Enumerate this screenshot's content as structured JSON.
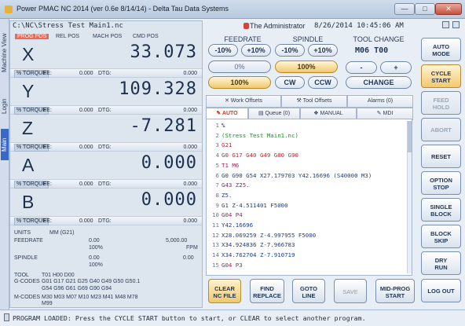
{
  "window": {
    "title": "Power PMAC NC 2014 (ver 0.6e 8/14/14) - Delta Tau Data Systems",
    "min": "—",
    "max": "□",
    "close": "✕"
  },
  "left_tabs": [
    "Machine View",
    "Login",
    "Main"
  ],
  "path": "C:\\NC\\Stress Test Main1.nc",
  "pos_headers": [
    "PROG POS",
    "REL POS",
    "MACH POS",
    "CMD POS"
  ],
  "axes": [
    {
      "letter": "X",
      "value": "33.073",
      "torque": "% TORQUE",
      "fe_label": "FE:",
      "fe": "0.000",
      "dtg_label": "DTG:",
      "dtg": "0.000"
    },
    {
      "letter": "Y",
      "value": "109.328",
      "torque": "% TORQUE",
      "fe_label": "FE:",
      "fe": "0.000",
      "dtg_label": "DTG:",
      "dtg": "0.000"
    },
    {
      "letter": "Z",
      "value": "-7.281",
      "torque": "% TORQUE",
      "fe_label": "FE:",
      "fe": "0.000",
      "dtg_label": "DTG:",
      "dtg": "0.000"
    },
    {
      "letter": "A",
      "value": "0.000",
      "torque": "% TORQUE",
      "fe_label": "FE:",
      "fe": "0.000",
      "dtg_label": "DTG:",
      "dtg": "0.000"
    },
    {
      "letter": "B",
      "value": "0.000",
      "torque": "% TORQUE",
      "fe_label": "FE:",
      "fe": "0.000",
      "dtg_label": "DTG:",
      "dtg": "0.000"
    }
  ],
  "info": {
    "units_label": "UNITS",
    "units": "MM (G21)",
    "feedrate_label": "FEEDRATE",
    "feedrate_val": "0.00",
    "feedrate_max": "5,000.00",
    "feedrate_pct": "100%",
    "feedrate_unit": "FPM",
    "spindle_label": "SPINDLE",
    "spindle_val": "0.00",
    "spindle_max": "0.00",
    "spindle_pct": "100%",
    "tool_label": "TOOL",
    "tool": "T01 H00 D00",
    "gcodes_label": "G-CODES",
    "gcodes_1": "G01 G17 G21 G25 G40 G49 G50 G50.1",
    "gcodes_2": "G54 G96 G61 G69 G90 G94",
    "mcodes_label": "M-CODES",
    "mcodes_1": "M30 M03 M07 M10 M23 M41 M48 M78",
    "mcodes_2": "M99"
  },
  "header": {
    "user": "The Administrator",
    "datetime": "8/26/2014 10:45:06 AM"
  },
  "feedrate": {
    "title": "FEEDRATE",
    "minus": "-10%",
    "plus": "+10%",
    "pct": "0%",
    "override": "100%"
  },
  "spindle": {
    "title": "SPINDLE",
    "minus": "-10%",
    "plus": "+10%",
    "pct": "100%",
    "cw": "CW",
    "ccw": "CCW"
  },
  "toolchange": {
    "title": "TOOL CHANGE",
    "codes": "M06  T00",
    "minus": "-",
    "plus": "+",
    "change": "CHANGE"
  },
  "tabs_top": [
    "Work Offsets",
    "Tool Offsets",
    "Alarms (0)"
  ],
  "tabs_mode": [
    "AUTO",
    "Queue (0)",
    "MANUAL",
    "MDI"
  ],
  "code_lines": [
    {
      "n": "1",
      "t": "%",
      "c": "#1d2b3d"
    },
    {
      "n": "2",
      "t": "(Stress Test Main1.nc)",
      "c": "#1f8a2e"
    },
    {
      "n": "3",
      "t": "G21",
      "c": "#d0202c"
    },
    {
      "n": "4",
      "t": "G0 G17 G40 G49 G80 G90",
      "c": "#d0202c"
    },
    {
      "n": "5",
      "t": "T1 M6",
      "c": "#a01e5a"
    },
    {
      "n": "6",
      "t": "G0 G90 G54 X27.179703 Y42.16696 (S40000 M3)",
      "c": "#1f3c8f"
    },
    {
      "n": "7",
      "t": "G43 Z25.",
      "c": "#a01e5a"
    },
    {
      "n": "8",
      "t": "Z5.",
      "c": "#1f3c8f"
    },
    {
      "n": "9",
      "t": "G1 Z-4.511401 F5000",
      "c": "#1f3c8f"
    },
    {
      "n": "10",
      "t": "G04 P4",
      "c": "#a01e5a"
    },
    {
      "n": "11",
      "t": "Y42.16696",
      "c": "#1f3c8f"
    },
    {
      "n": "12",
      "t": "X28.069259 Z-4.997955 F5000",
      "c": "#1f3c8f"
    },
    {
      "n": "13",
      "t": "X34.924836 Z-7.966783",
      "c": "#1f3c8f"
    },
    {
      "n": "14",
      "t": "X34.762704 Z-7.910719",
      "c": "#1f3c8f"
    },
    {
      "n": "15",
      "t": "G04 P3",
      "c": "#a01e5a"
    }
  ],
  "bottom_buttons": [
    {
      "l1": "CLEAR",
      "l2": "NC FILE"
    },
    {
      "l1": "FIND",
      "l2": "REPLACE"
    },
    {
      "l1": "GOTO",
      "l2": "LINE"
    },
    {
      "l1": "SAVE",
      "l2": ""
    },
    {
      "l1": "MID-PROG",
      "l2": "START"
    }
  ],
  "side_buttons": [
    {
      "l1": "AUTO",
      "l2": "MODE"
    },
    {
      "l1": "CYCLE",
      "l2": "START"
    },
    {
      "l1": "FEED",
      "l2": "HOLD"
    },
    {
      "l1": "ABORT",
      "l2": ""
    },
    {
      "l1": "RESET",
      "l2": ""
    },
    {
      "l1": "OPTION",
      "l2": "STOP"
    },
    {
      "l1": "SINGLE",
      "l2": "BLOCK"
    },
    {
      "l1": "BLOCK",
      "l2": "SKIP"
    },
    {
      "l1": "DRY",
      "l2": "RUN"
    },
    {
      "l1": "LOG OUT",
      "l2": ""
    }
  ],
  "status": "PROGRAM LOADED:  Press the CYCLE START button to start, or CLEAR to select another program.",
  "colors": {
    "accent": "#e86a5a",
    "selected": "#f0c86b",
    "frame": "#dce3ec"
  }
}
